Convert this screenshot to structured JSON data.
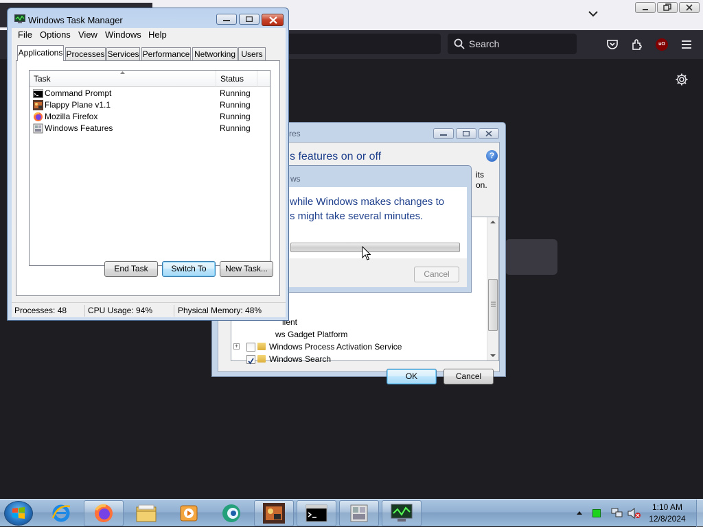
{
  "firefox": {
    "search_placeholder": "Search",
    "extension_badge": "uO"
  },
  "windows_features": {
    "title_partial": "res",
    "heading_partial": "s features on or off",
    "help_icon": "?",
    "desc_partial_1": "its",
    "desc_partial_2": "on.",
    "features": [
      {
        "label_partial": "lient",
        "expander": "",
        "checked": false
      },
      {
        "label_partial": "ws Gadget Platform",
        "expander": "",
        "checked": false
      },
      {
        "label": "Windows Process Activation Service",
        "expander": "+",
        "checked": false
      },
      {
        "label": "Windows Search",
        "expander": "",
        "checked": true
      }
    ],
    "ok_label": "OK",
    "cancel_label": "Cancel"
  },
  "progress_dialog": {
    "title_partial": "ws",
    "message_line1": "while Windows makes changes to",
    "message_line2": "s might take several minutes.",
    "cancel_label": "Cancel"
  },
  "task_manager": {
    "title": "Windows Task Manager",
    "menu": [
      "File",
      "Options",
      "View",
      "Windows",
      "Help"
    ],
    "tabs": [
      "Applications",
      "Processes",
      "Services",
      "Performance",
      "Networking",
      "Users"
    ],
    "active_tab": "Applications",
    "columns": [
      "Task",
      "Status"
    ],
    "tasks": [
      {
        "name": "Command Prompt",
        "status": "Running",
        "icon": "cmd-icon"
      },
      {
        "name": "Flappy Plane v1.1",
        "status": "Running",
        "icon": "flappy-plane-icon"
      },
      {
        "name": "Mozilla Firefox",
        "status": "Running",
        "icon": "firefox-icon"
      },
      {
        "name": "Windows Features",
        "status": "Running",
        "icon": "windows-features-icon"
      }
    ],
    "buttons": {
      "end_task": "End Task",
      "switch_to": "Switch To",
      "new_task": "New Task..."
    },
    "status": {
      "processes": "Processes: 48",
      "cpu": "CPU Usage: 94%",
      "memory": "Physical Memory: 48%"
    }
  },
  "taskbar": {
    "pinned": [
      "start-orb",
      "internet-explorer-icon",
      "firefox-icon",
      "file-explorer-icon",
      "media-player-icon",
      "app-icon",
      "flappy-plane-icon",
      "cmd-icon",
      "windows-features-icon",
      "task-manager-icon"
    ],
    "clock_time": "1:10 AM",
    "clock_date": "12/8/2024"
  }
}
